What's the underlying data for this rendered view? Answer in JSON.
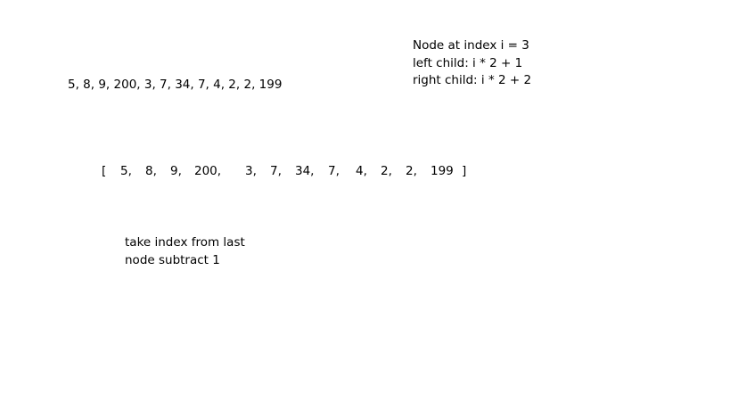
{
  "sequence_text": "5, 8, 9, 200, 3, 7, 34, 7, 4, 2, 2, 199",
  "index_note": {
    "line1": "Node at index i = 3",
    "line2": "left child: i * 2 + 1",
    "line3": "right child: i * 2 + 2"
  },
  "array": {
    "open_bracket": "[",
    "close_bracket": "]",
    "items": [
      "5,",
      "8,",
      "9,",
      "200,",
      "3,",
      "7,",
      "34,",
      "7,",
      "4,",
      "2,",
      "2,",
      "199"
    ]
  },
  "last_note": {
    "line1": "take index from last",
    "line2": "node subtract 1"
  }
}
